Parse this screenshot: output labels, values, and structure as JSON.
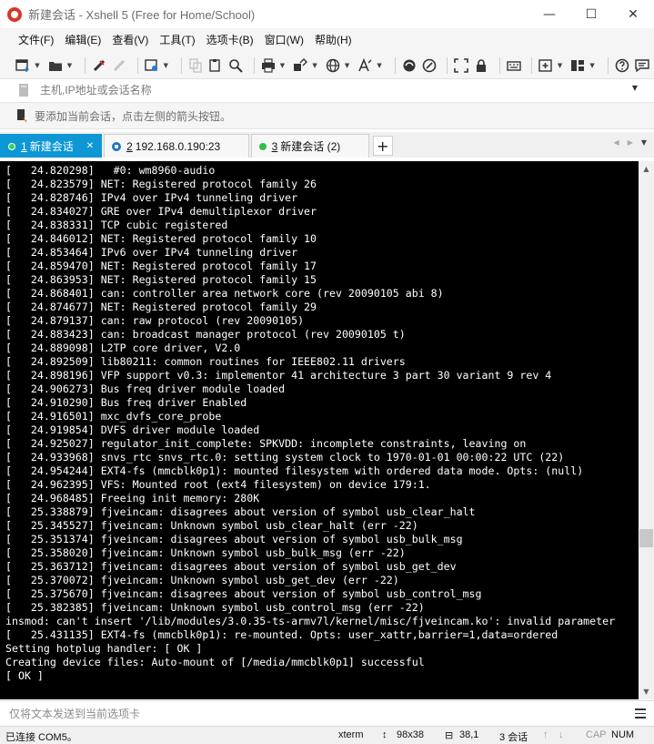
{
  "window": {
    "title": "新建会话 - Xshell 5 (Free for Home/School)",
    "minimize": "—",
    "maximize": "☐",
    "close": "✕"
  },
  "menu": [
    "文件(F)",
    "编辑(E)",
    "查看(V)",
    "工具(T)",
    "选项卡(B)",
    "窗口(W)",
    "帮助(H)"
  ],
  "address": {
    "placeholder": "主机,IP地址或会话名称"
  },
  "hint": {
    "text": "要添加当前会话，点击左侧的箭头按钮。"
  },
  "tabs": [
    {
      "number": "1",
      "label": "新建会话",
      "status": "connected",
      "active": true
    },
    {
      "number": "2",
      "label": "192.168.0.190:23",
      "status": "secure",
      "active": false
    },
    {
      "number": "3",
      "label": "新建会话 (2)",
      "status": "connected",
      "active": false
    }
  ],
  "tab_add": "+",
  "terminal": {
    "lines": [
      "[   24.820298]   #0: wm8960-audio",
      "[   24.823579] NET: Registered protocol family 26",
      "[   24.828746] IPv4 over IPv4 tunneling driver",
      "[   24.834027] GRE over IPv4 demultiplexor driver",
      "[   24.838331] TCP cubic registered",
      "[   24.846012] NET: Registered protocol family 10",
      "[   24.853464] IPv6 over IPv4 tunneling driver",
      "[   24.859470] NET: Registered protocol family 17",
      "[   24.863953] NET: Registered protocol family 15",
      "[   24.868401] can: controller area network core (rev 20090105 abi 8)",
      "[   24.874677] NET: Registered protocol family 29",
      "[   24.879137] can: raw protocol (rev 20090105)",
      "[   24.883423] can: broadcast manager protocol (rev 20090105 t)",
      "[   24.889098] L2TP core driver, V2.0",
      "[   24.892509] lib80211: common routines for IEEE802.11 drivers",
      "[   24.898196] VFP support v0.3: implementor 41 architecture 3 part 30 variant 9 rev 4",
      "[   24.906273] Bus freq driver module loaded",
      "[   24.910290] Bus freq driver Enabled",
      "[   24.916501] mxc_dvfs_core_probe",
      "[   24.919854] DVFS driver module loaded",
      "[   24.925027] regulator_init_complete: SPKVDD: incomplete constraints, leaving on",
      "[   24.933968] snvs_rtc snvs_rtc.0: setting system clock to 1970-01-01 00:00:22 UTC (22)",
      "[   24.954244] EXT4-fs (mmcblk0p1): mounted filesystem with ordered data mode. Opts: (null)",
      "[   24.962395] VFS: Mounted root (ext4 filesystem) on device 179:1.",
      "[   24.968485] Freeing init memory: 280K",
      "[   25.338879] fjveincam: disagrees about version of symbol usb_clear_halt",
      "[   25.345527] fjveincam: Unknown symbol usb_clear_halt (err -22)",
      "[   25.351374] fjveincam: disagrees about version of symbol usb_bulk_msg",
      "[   25.358020] fjveincam: Unknown symbol usb_bulk_msg (err -22)",
      "[   25.363712] fjveincam: disagrees about version of symbol usb_get_dev",
      "[   25.370072] fjveincam: Unknown symbol usb_get_dev (err -22)",
      "[   25.375670] fjveincam: disagrees about version of symbol usb_control_msg",
      "[   25.382385] fjveincam: Unknown symbol usb_control_msg (err -22)",
      "insmod: can't insert '/lib/modules/3.0.35-ts-armv7l/kernel/misc/fjveincam.ko': invalid parameter",
      "[   25.431135] EXT4-fs (mmcblk0p1): re-mounted. Opts: user_xattr,barrier=1,data=ordered",
      "Setting hotplug handler: [ OK ]",
      "Creating device files: Auto-mount of [/media/mmcblk0p1] successful",
      "[ OK ]"
    ]
  },
  "send": {
    "placeholder": "仅将文本发送到当前选项卡"
  },
  "status": {
    "connection": "已连接 COM5。",
    "term_type": "xterm",
    "size": "98x38",
    "cursor": "38,1",
    "sessions": "3 会话",
    "cap": "CAP",
    "num": "NUM"
  }
}
